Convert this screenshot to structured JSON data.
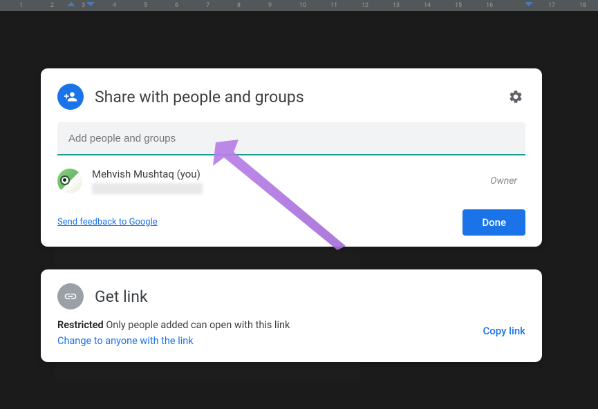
{
  "ruler": {
    "ticks": [
      "1",
      "2",
      "3",
      "4",
      "5",
      "6",
      "7",
      "8",
      "9",
      "10",
      "11",
      "12",
      "13",
      "14",
      "15",
      "16",
      "17",
      "18"
    ]
  },
  "share": {
    "title": "Share with people and groups",
    "input_placeholder": "Add people and groups",
    "person_name": "Mehvish Mushtaq (you)",
    "person_role": "Owner",
    "feedback": "Send feedback to Google",
    "done": "Done"
  },
  "link": {
    "title": "Get link",
    "restricted_bold": "Restricted",
    "restricted_text": " Only people added can open with this link",
    "change": "Change to anyone with the link",
    "copy": "Copy link"
  }
}
